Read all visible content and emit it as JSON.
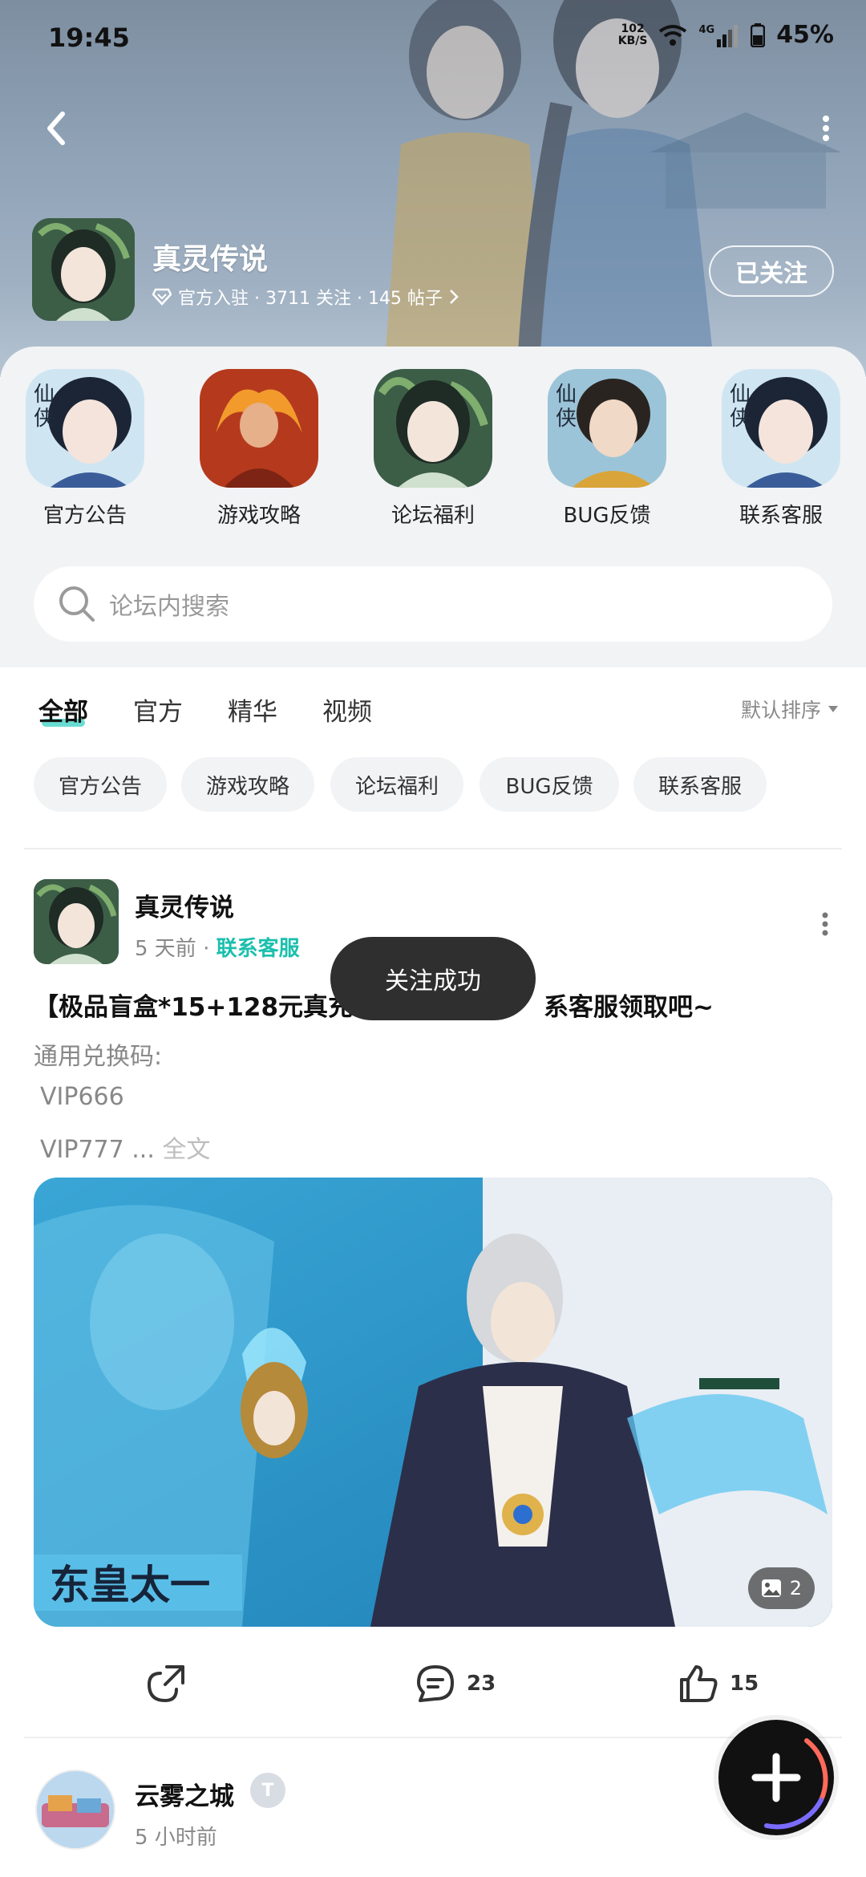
{
  "status_bar": {
    "time": "19:45",
    "net_speed_value": "102",
    "net_speed_unit": "KB/S",
    "signal_label": "4G",
    "battery": "45%"
  },
  "forum": {
    "name": "真灵传说",
    "meta": "官方入驻 · 3711 关注 · 145 帖子",
    "follow_label": "已关注"
  },
  "shortcuts": [
    {
      "label": "官方公告",
      "icon": "announcement-icon"
    },
    {
      "label": "游戏攻略",
      "icon": "guide-icon"
    },
    {
      "label": "论坛福利",
      "icon": "welfare-icon"
    },
    {
      "label": "BUG反馈",
      "icon": "bug-report-icon"
    },
    {
      "label": "联系客服",
      "icon": "customer-service-icon"
    }
  ],
  "search": {
    "placeholder": "论坛内搜索"
  },
  "tabs": [
    {
      "label": "全部",
      "active": true
    },
    {
      "label": "官方",
      "active": false
    },
    {
      "label": "精华",
      "active": false
    },
    {
      "label": "视频",
      "active": false
    }
  ],
  "sort_label": "默认排序",
  "chips": [
    "官方公告",
    "游戏攻略",
    "论坛福利",
    "BUG反馈",
    "联系客服"
  ],
  "post": {
    "author": "真灵传说",
    "time": "5 天前",
    "separator": "·",
    "category": "联系客服",
    "title": "【极品盲盒*15+128元真充",
    "title_tail": "系客服领取吧~",
    "lines": [
      "通用兑换码:",
      "VIP666",
      "VIP777 ..."
    ],
    "more_label": "全文",
    "image_caption": "东皇太一",
    "image_count": "2",
    "comments": "23",
    "likes": "15"
  },
  "post2": {
    "author": "云雾之城",
    "badge": "T",
    "time": "5 小时前"
  },
  "toast": "关注成功",
  "colors": {
    "accent": "#1bbfae",
    "tab_underline": "#37d0c3",
    "toast_bg": "#2f2f2f"
  }
}
